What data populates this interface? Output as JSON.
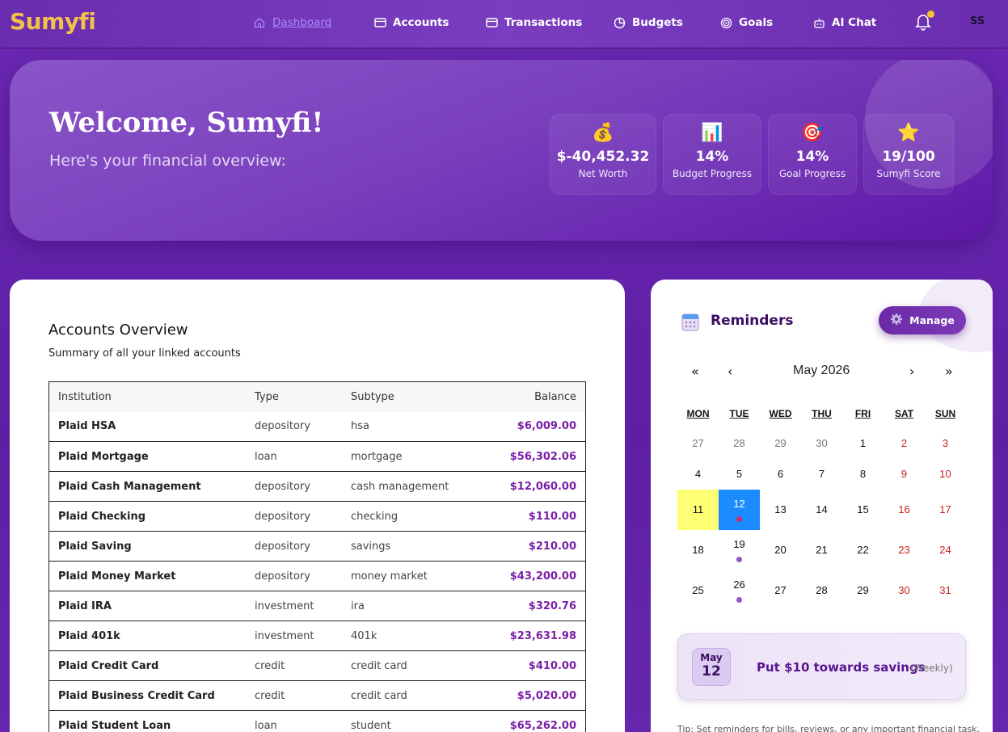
{
  "brand": "Sumyfi",
  "nav": {
    "items": [
      {
        "label": "Dashboard",
        "icon": "home-icon"
      },
      {
        "label": "Accounts",
        "icon": "card-icon"
      },
      {
        "label": "Transactions",
        "icon": "card-icon"
      },
      {
        "label": "Budgets",
        "icon": "pie-icon"
      },
      {
        "label": "Goals",
        "icon": "target-icon"
      },
      {
        "label": "AI Chat",
        "icon": "robot-icon"
      }
    ],
    "avatar": "SS"
  },
  "hero": {
    "welcome": "Welcome, Sumyfi!",
    "subtitle": "Here's your financial overview:",
    "stats": [
      {
        "icon": "💰",
        "value": "$-40,452.32",
        "label": "Net Worth"
      },
      {
        "icon": "📊",
        "value": "14%",
        "label": "Budget Progress"
      },
      {
        "icon": "🎯",
        "value": "14%",
        "label": "Goal Progress"
      },
      {
        "icon": "⭐",
        "value": "19/100",
        "label": "Sumyfi Score"
      }
    ]
  },
  "accounts": {
    "title": "Accounts Overview",
    "subtitle": "Summary of all your linked accounts",
    "columns": [
      "Institution",
      "Type",
      "Subtype",
      "Balance"
    ],
    "rows": [
      [
        "Plaid HSA",
        "depository",
        "hsa",
        "$6,009.00"
      ],
      [
        "Plaid Mortgage",
        "loan",
        "mortgage",
        "$56,302.06"
      ],
      [
        "Plaid Cash Management",
        "depository",
        "cash management",
        "$12,060.00"
      ],
      [
        "Plaid Checking",
        "depository",
        "checking",
        "$110.00"
      ],
      [
        "Plaid Saving",
        "depository",
        "savings",
        "$210.00"
      ],
      [
        "Plaid Money Market",
        "depository",
        "money market",
        "$43,200.00"
      ],
      [
        "Plaid IRA",
        "investment",
        "ira",
        "$320.76"
      ],
      [
        "Plaid 401k",
        "investment",
        "401k",
        "$23,631.98"
      ],
      [
        "Plaid Credit Card",
        "credit",
        "credit card",
        "$410.00"
      ],
      [
        "Plaid Business Credit Card",
        "credit",
        "credit card",
        "$5,020.00"
      ],
      [
        "Plaid Student Loan",
        "loan",
        "student",
        "$65,262.00"
      ]
    ]
  },
  "reminders": {
    "title": "Reminders",
    "manage_label": "Manage",
    "calendar": {
      "nav_prev_year": "«",
      "nav_prev": "‹",
      "nav_next": "›",
      "nav_next_year": "»",
      "month": "May 2026",
      "weekdays": [
        "MON",
        "TUE",
        "WED",
        "THU",
        "FRI",
        "SAT",
        "SUN"
      ]
    },
    "item": {
      "month": "May",
      "day": "12",
      "text": "Put $10 towards savings",
      "frequency": "(Weekly)"
    },
    "tip": "Tip: Set reminders for bills, reviews, or any important financial task."
  }
}
